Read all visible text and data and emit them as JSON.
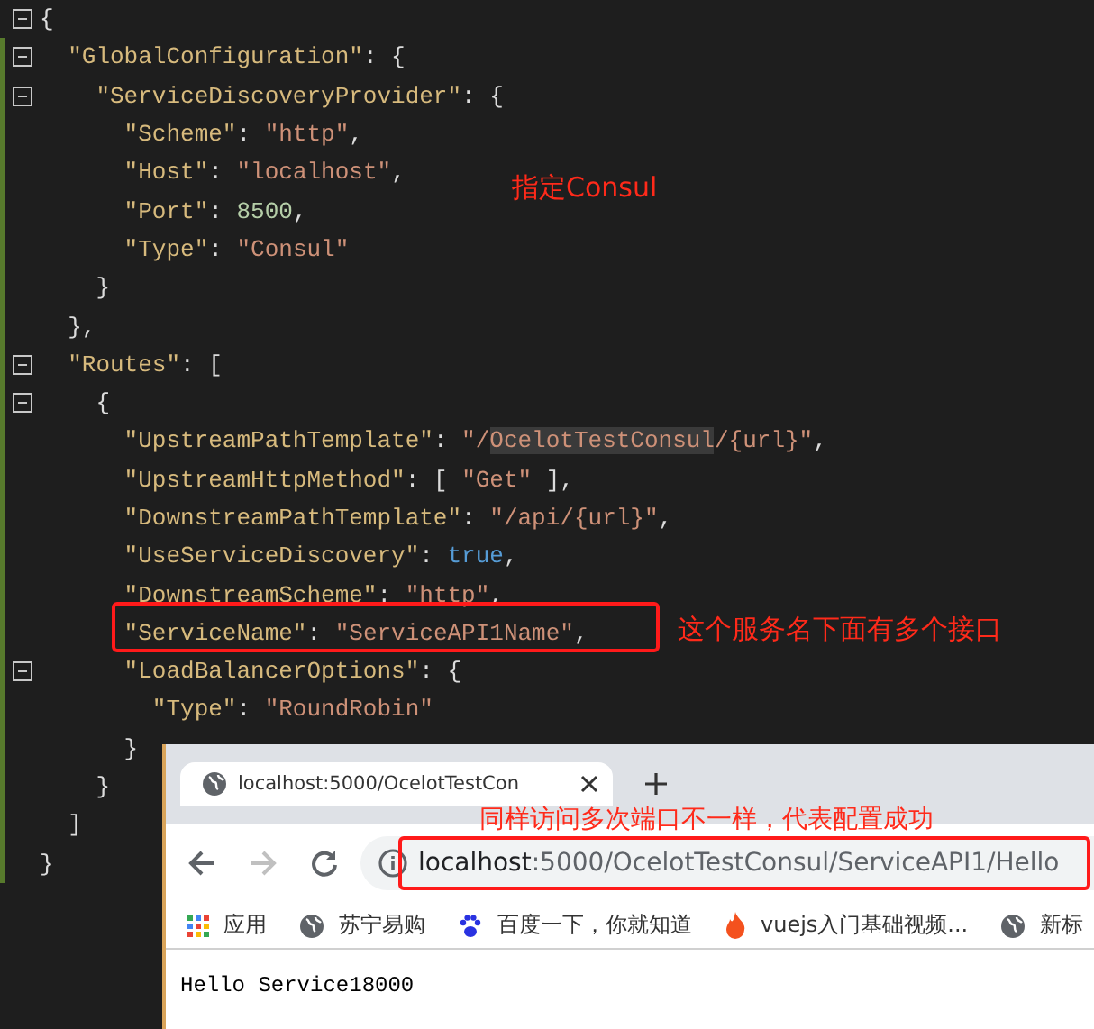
{
  "editor": {
    "lines": [
      {
        "changed": false,
        "fold": true,
        "tokens": [
          {
            "kind": "punct",
            "text": "{"
          }
        ]
      },
      {
        "changed": true,
        "fold": true,
        "tokens": [
          {
            "kind": "key",
            "text": "  \"GlobalConfiguration\""
          },
          {
            "kind": "punct",
            "text": ": {"
          }
        ]
      },
      {
        "changed": true,
        "fold": true,
        "tokens": [
          {
            "kind": "key",
            "text": "    \"ServiceDiscoveryProvider\""
          },
          {
            "kind": "punct",
            "text": ": {"
          }
        ]
      },
      {
        "changed": true,
        "fold": false,
        "tokens": [
          {
            "kind": "key",
            "text": "      \"Scheme\""
          },
          {
            "kind": "punct",
            "text": ": "
          },
          {
            "kind": "string",
            "text": "\"http\""
          },
          {
            "kind": "punct",
            "text": ","
          }
        ]
      },
      {
        "changed": true,
        "fold": false,
        "tokens": [
          {
            "kind": "key",
            "text": "      \"Host\""
          },
          {
            "kind": "punct",
            "text": ": "
          },
          {
            "kind": "string",
            "text": "\"localhost\""
          },
          {
            "kind": "punct",
            "text": ","
          }
        ]
      },
      {
        "changed": true,
        "fold": false,
        "tokens": [
          {
            "kind": "key",
            "text": "      \"Port\""
          },
          {
            "kind": "punct",
            "text": ": "
          },
          {
            "kind": "number",
            "text": "8500"
          },
          {
            "kind": "punct",
            "text": ","
          }
        ]
      },
      {
        "changed": true,
        "fold": false,
        "tokens": [
          {
            "kind": "key",
            "text": "      \"Type\""
          },
          {
            "kind": "punct",
            "text": ": "
          },
          {
            "kind": "string",
            "text": "\"Consul\""
          }
        ]
      },
      {
        "changed": true,
        "fold": false,
        "tokens": [
          {
            "kind": "punct",
            "text": "    }"
          }
        ]
      },
      {
        "changed": true,
        "fold": false,
        "tokens": [
          {
            "kind": "punct",
            "text": "  },"
          }
        ]
      },
      {
        "changed": true,
        "fold": true,
        "tokens": [
          {
            "kind": "key",
            "text": "  \"Routes\""
          },
          {
            "kind": "punct",
            "text": ": ["
          }
        ]
      },
      {
        "changed": true,
        "fold": true,
        "tokens": [
          {
            "kind": "punct",
            "text": "    {"
          }
        ]
      },
      {
        "changed": true,
        "fold": false,
        "tokens": [
          {
            "kind": "key",
            "text": "      \"UpstreamPathTemplate\""
          },
          {
            "kind": "punct",
            "text": ": "
          },
          {
            "kind": "string",
            "text": "\"/"
          },
          {
            "kind": "highlight",
            "text": "OcelotTestConsul"
          },
          {
            "kind": "string",
            "text": "/{url}\""
          },
          {
            "kind": "punct",
            "text": ","
          }
        ]
      },
      {
        "changed": true,
        "fold": false,
        "tokens": [
          {
            "kind": "key",
            "text": "      \"UpstreamHttpMethod\""
          },
          {
            "kind": "punct",
            "text": ": [ "
          },
          {
            "kind": "string",
            "text": "\"Get\""
          },
          {
            "kind": "punct",
            "text": " ],"
          }
        ]
      },
      {
        "changed": true,
        "fold": false,
        "tokens": [
          {
            "kind": "key",
            "text": "      \"DownstreamPathTemplate\""
          },
          {
            "kind": "punct",
            "text": ": "
          },
          {
            "kind": "string",
            "text": "\"/api/{url}\""
          },
          {
            "kind": "punct",
            "text": ","
          }
        ]
      },
      {
        "changed": true,
        "fold": false,
        "tokens": [
          {
            "kind": "key",
            "text": "      \"UseServiceDiscovery\""
          },
          {
            "kind": "punct",
            "text": ": "
          },
          {
            "kind": "keyword",
            "text": "true"
          },
          {
            "kind": "punct",
            "text": ","
          }
        ]
      },
      {
        "changed": true,
        "fold": false,
        "tokens": [
          {
            "kind": "key",
            "text": "      \"DownstreamScheme\""
          },
          {
            "kind": "punct",
            "text": ": "
          },
          {
            "kind": "string",
            "text": "\"http\""
          },
          {
            "kind": "punct",
            "text": ","
          }
        ]
      },
      {
        "changed": true,
        "fold": false,
        "tokens": [
          {
            "kind": "key",
            "text": "      \"ServiceName\""
          },
          {
            "kind": "punct",
            "text": ": "
          },
          {
            "kind": "string",
            "text": "\"ServiceAPI1Name\""
          },
          {
            "kind": "punct",
            "text": ","
          }
        ]
      },
      {
        "changed": true,
        "fold": true,
        "tokens": [
          {
            "kind": "key",
            "text": "      \"LoadBalancerOptions\""
          },
          {
            "kind": "punct",
            "text": ": {"
          }
        ]
      },
      {
        "changed": true,
        "fold": false,
        "tokens": [
          {
            "kind": "key",
            "text": "        \"Type\""
          },
          {
            "kind": "punct",
            "text": ": "
          },
          {
            "kind": "string",
            "text": "\"RoundRobin\""
          }
        ]
      },
      {
        "changed": true,
        "fold": false,
        "tokens": [
          {
            "kind": "punct",
            "text": "      }"
          }
        ]
      },
      {
        "changed": true,
        "fold": false,
        "tokens": [
          {
            "kind": "punct",
            "text": "    }"
          }
        ]
      },
      {
        "changed": true,
        "fold": false,
        "tokens": [
          {
            "kind": "punct",
            "text": "  ]"
          }
        ]
      },
      {
        "changed": true,
        "fold": false,
        "tokens": [
          {
            "kind": "punct",
            "text": "}"
          }
        ]
      }
    ],
    "notes": [
      "指定Consul",
      "这个服务名下面有多个接口"
    ]
  },
  "browser": {
    "tabs": [
      {
        "title": "localhost:5000/OcelotTestCon",
        "selected": true
      }
    ],
    "note": "同样访问多次端口不一样，代表配置成功",
    "nav_buttons": [
      {
        "kind": "back",
        "disabled": false
      },
      {
        "kind": "forward",
        "disabled": true
      },
      {
        "kind": "reload",
        "disabled": false
      }
    ],
    "address_bar": {
      "host": "localhost",
      "rest": ":5000/OcelotTestConsul/ServiceAPI1/Hello"
    },
    "bookmarks": [
      {
        "kind": "apps",
        "label": "应用"
      },
      {
        "kind": "globe",
        "label": "苏宁易购"
      },
      {
        "kind": "paw",
        "label": "百度一下，你就知道"
      },
      {
        "kind": "flame",
        "label": "vuejs入门基础视频..."
      },
      {
        "kind": "globe",
        "label": "新标"
      }
    ],
    "page_text": "Hello Service18000"
  }
}
